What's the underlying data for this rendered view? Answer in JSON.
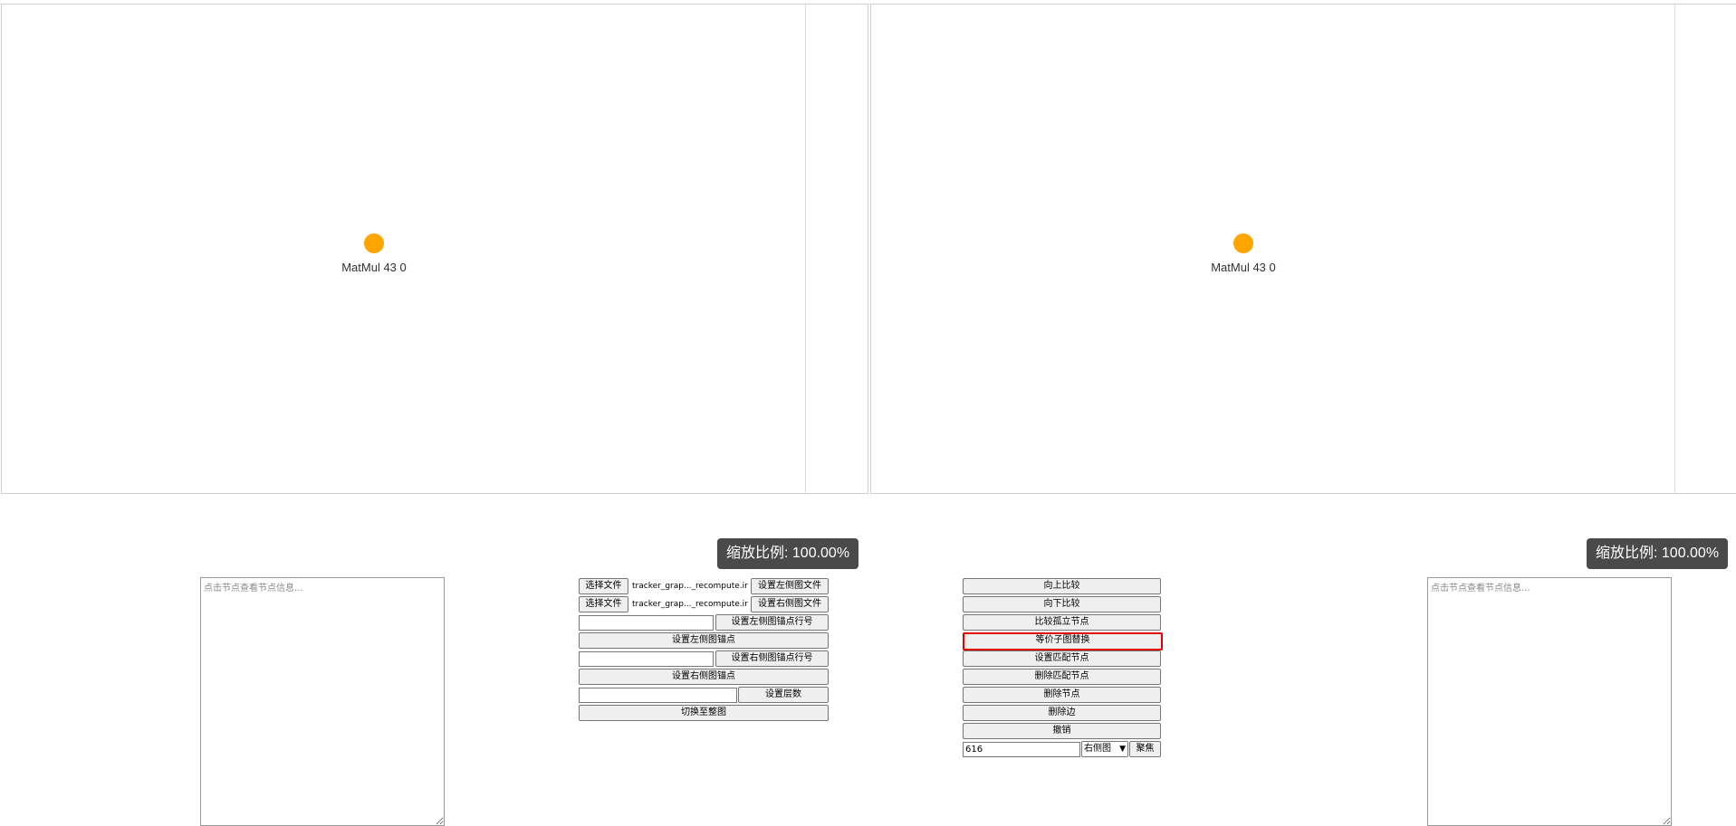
{
  "left_graph": {
    "node": {
      "label": "MatMul 43 0",
      "color": "#ffa500"
    },
    "zoom": "缩放比例: 100.00%",
    "info_placeholder": "点击节点查看节点信息..."
  },
  "right_graph": {
    "node": {
      "label": "MatMul 43 0",
      "color": "#ffa500"
    },
    "zoom": "缩放比例: 100.00%",
    "info_placeholder": "点击节点查看节点信息..."
  },
  "file_controls": {
    "choose_file_label": "选择文件",
    "left_file_name": "tracker_grap..._recompute.ir",
    "right_file_name": "tracker_grap..._recompute.ir",
    "set_left_file": "设置左侧图文件",
    "set_right_file": "设置右侧图文件",
    "left_anchor_line_value": "",
    "set_left_anchor_line": "设置左侧图锚点行号",
    "set_left_anchor": "设置左侧图锚点",
    "right_anchor_line_value": "",
    "set_right_anchor_line": "设置右侧图锚点行号",
    "set_right_anchor": "设置右侧图锚点",
    "layer_value": "",
    "set_layers": "设置层数",
    "switch_to_full": "切换至整图"
  },
  "compare_controls": {
    "compare_up": "向上比较",
    "compare_down": "向下比较",
    "compare_isolated": "比较孤立节点",
    "equiv_subgraph_replace": "等价子图替换",
    "set_match_nodes": "设置匹配节点",
    "delete_match_nodes": "删除匹配节点",
    "delete_node": "删除节点",
    "delete_edge": "删除边",
    "undo": "撤销",
    "focus_input_value": "616",
    "graph_select_value": "右侧图",
    "focus_button": "聚焦"
  },
  "colors": {
    "highlight_border": "#e00000",
    "zoom_badge_bg": "#4a4a4a"
  }
}
